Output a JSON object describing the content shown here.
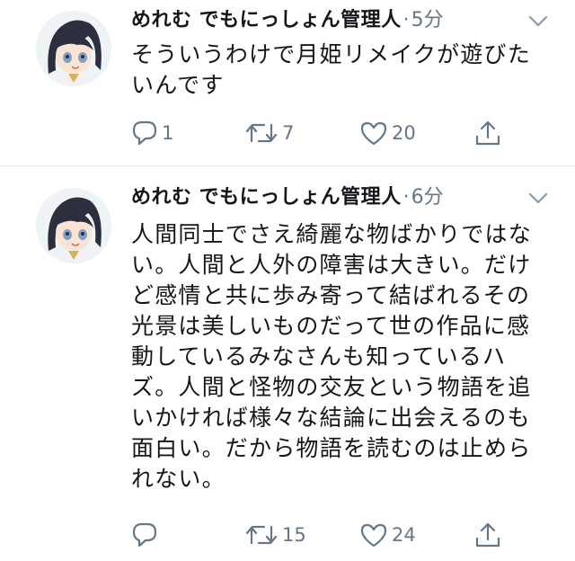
{
  "tweets": [
    {
      "user_name": "めれむ でもにっしょん管理人",
      "separator": "·",
      "time": "5分",
      "text": "そういうわけで月姫リメイクが遊びたいんです",
      "text_lines": [
        "そういうわけで月姫リメイクが遊びた",
        "いんです"
      ],
      "reply_count": "1",
      "retweet_count": "7",
      "like_count": "20",
      "share_count": ""
    },
    {
      "user_name": "めれむ でもにっしょん管理人",
      "separator": "·",
      "time": "6分",
      "text": "人間同士でさえ綺麗な物ばかりではない。人間と人外の障害は大きい。だけど感情と共に歩み寄って結ばれるその光景は美しいものだって世の作品に感動しているみなさんも知っているハズ。人間と怪物の交友という物語を追いかければ様々な結論に出会えるのも面白い。だから物語を読むのは止められない。",
      "text_lines": [
        "人間同士でさえ綺麗な物ばかりではな",
        "い。人間と人外の障害は大きい。だけ",
        "ど感情と共に歩み寄って結ばれるその",
        "光景は美しいものだって世の作品に感",
        "動しているみなさんも知っているハ",
        "ズ。人間と怪物の交友という物語を追",
        "いかければ様々な結論に出会えるのも",
        "面白い。だから物語を読むのは止めら",
        "れない。"
      ],
      "reply_count": "",
      "retweet_count": "15",
      "like_count": "24",
      "share_count": ""
    }
  ],
  "icons": {
    "avatar": "anime-girl-avatar",
    "more": "chevron-down-icon",
    "reply": "reply-icon",
    "retweet": "retweet-icon",
    "like": "heart-icon",
    "share": "share-icon"
  },
  "colors": {
    "text": "#14171a",
    "secondary": "#657786",
    "divider": "#e1e8ed"
  }
}
